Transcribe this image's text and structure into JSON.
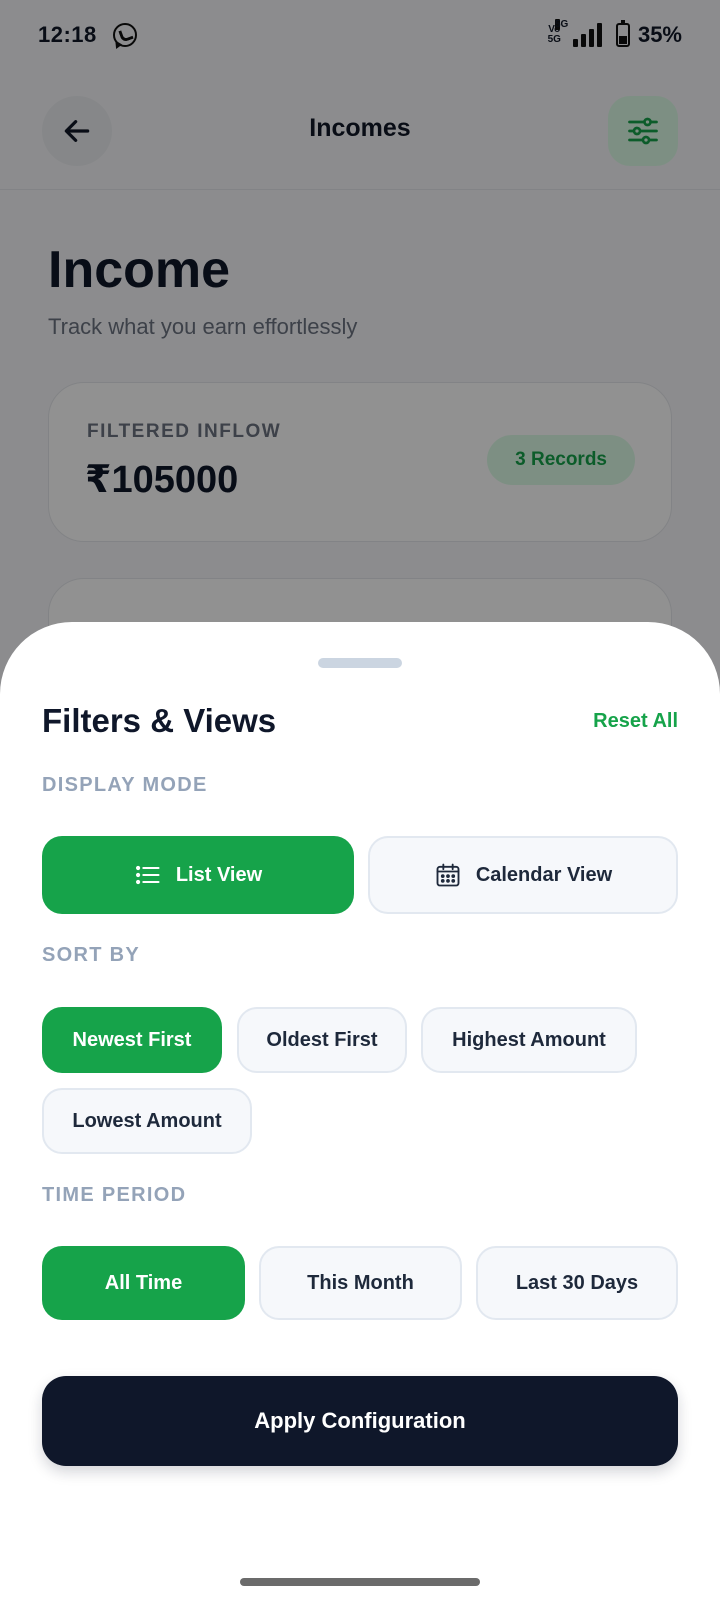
{
  "status_bar": {
    "time": "12:18",
    "network_vo": "Vo",
    "network_5g": "5G",
    "signal_label": "5G",
    "battery": "35%"
  },
  "header": {
    "title": "Incomes"
  },
  "page": {
    "title": "Income",
    "subtitle": "Track what you earn effortlessly"
  },
  "summary": {
    "label": "FILTERED INFLOW",
    "amount": "₹105000",
    "records": "3 Records"
  },
  "sheet": {
    "title": "Filters & Views",
    "reset_label": "Reset All",
    "display_mode": {
      "label": "DISPLAY MODE",
      "options": [
        {
          "label": "List View",
          "icon": "list-icon",
          "active": true
        },
        {
          "label": "Calendar View",
          "icon": "calendar-icon",
          "active": false
        }
      ]
    },
    "sort_by": {
      "label": "SORT BY",
      "options": [
        {
          "label": "Newest First",
          "active": true
        },
        {
          "label": "Oldest First",
          "active": false
        },
        {
          "label": "Highest Amount",
          "active": false
        },
        {
          "label": "Lowest Amount",
          "active": false
        }
      ]
    },
    "time_period": {
      "label": "TIME PERIOD",
      "options": [
        {
          "label": "All Time",
          "active": true
        },
        {
          "label": "This Month",
          "active": false
        },
        {
          "label": "Last 30 Days",
          "active": false
        }
      ]
    },
    "apply_label": "Apply Configuration"
  },
  "colors": {
    "accent": "#16a34a",
    "dark": "#0f172a",
    "muted": "#94a3b8"
  }
}
